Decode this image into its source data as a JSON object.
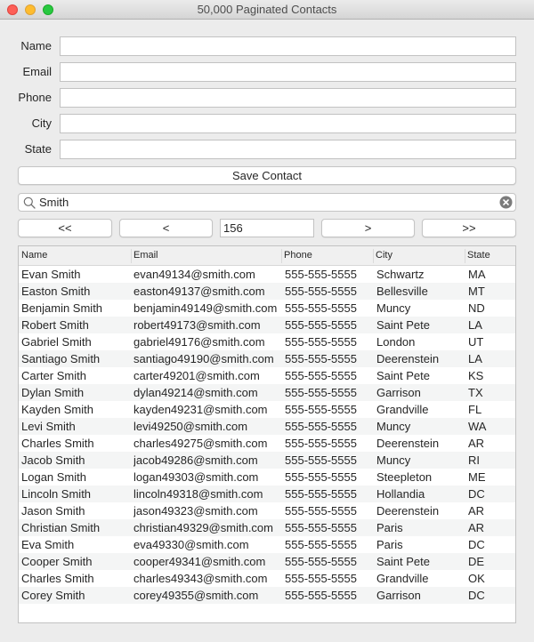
{
  "window": {
    "title": "50,000 Paginated Contacts"
  },
  "form": {
    "fields": [
      {
        "label": "Name",
        "value": ""
      },
      {
        "label": "Email",
        "value": ""
      },
      {
        "label": "Phone",
        "value": ""
      },
      {
        "label": "City",
        "value": ""
      },
      {
        "label": "State",
        "value": ""
      }
    ],
    "save_label": "Save Contact"
  },
  "search": {
    "value": "Smith",
    "icon": "search-icon",
    "clear_icon": "clear-icon"
  },
  "pagination": {
    "first_label": "<<",
    "prev_label": "<",
    "page": "156",
    "next_label": ">",
    "last_label": ">>"
  },
  "table": {
    "columns": [
      "Name",
      "Email",
      "Phone",
      "City",
      "State"
    ],
    "rows": [
      [
        "Evan Smith",
        "evan49134@smith.com",
        "555-555-5555",
        "Schwartz",
        "MA"
      ],
      [
        "Easton Smith",
        "easton49137@smith.com",
        "555-555-5555",
        "Bellesville",
        "MT"
      ],
      [
        "Benjamin Smith",
        "benjamin49149@smith.com",
        "555-555-5555",
        "Muncy",
        "ND"
      ],
      [
        "Robert Smith",
        "robert49173@smith.com",
        "555-555-5555",
        "Saint Pete",
        "LA"
      ],
      [
        "Gabriel Smith",
        "gabriel49176@smith.com",
        "555-555-5555",
        "London",
        "UT"
      ],
      [
        "Santiago Smith",
        "santiago49190@smith.com",
        "555-555-5555",
        "Deerenstein",
        "LA"
      ],
      [
        "Carter Smith",
        "carter49201@smith.com",
        "555-555-5555",
        "Saint Pete",
        "KS"
      ],
      [
        "Dylan Smith",
        "dylan49214@smith.com",
        "555-555-5555",
        "Garrison",
        "TX"
      ],
      [
        "Kayden Smith",
        "kayden49231@smith.com",
        "555-555-5555",
        "Grandville",
        "FL"
      ],
      [
        "Levi Smith",
        "levi49250@smith.com",
        "555-555-5555",
        "Muncy",
        "WA"
      ],
      [
        "Charles Smith",
        "charles49275@smith.com",
        "555-555-5555",
        "Deerenstein",
        "AR"
      ],
      [
        "Jacob Smith",
        "jacob49286@smith.com",
        "555-555-5555",
        "Muncy",
        "RI"
      ],
      [
        "Logan Smith",
        "logan49303@smith.com",
        "555-555-5555",
        "Steepleton",
        "ME"
      ],
      [
        "Lincoln Smith",
        "lincoln49318@smith.com",
        "555-555-5555",
        "Hollandia",
        "DC"
      ],
      [
        "Jason Smith",
        "jason49323@smith.com",
        "555-555-5555",
        "Deerenstein",
        "AR"
      ],
      [
        "Christian Smith",
        "christian49329@smith.com",
        "555-555-5555",
        "Paris",
        "AR"
      ],
      [
        "Eva Smith",
        "eva49330@smith.com",
        "555-555-5555",
        "Paris",
        "DC"
      ],
      [
        "Cooper Smith",
        "cooper49341@smith.com",
        "555-555-5555",
        "Saint Pete",
        "DE"
      ],
      [
        "Charles Smith",
        "charles49343@smith.com",
        "555-555-5555",
        "Grandville",
        "OK"
      ],
      [
        "Corey Smith",
        "corey49355@smith.com",
        "555-555-5555",
        "Garrison",
        "DC"
      ]
    ]
  }
}
